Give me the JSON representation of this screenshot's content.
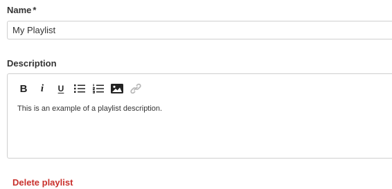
{
  "form": {
    "name_label": "Name",
    "required_marker": "*",
    "name_value": "My Playlist",
    "description_label": "Description",
    "description_text": "This is an example of a playlist description.",
    "delete_label": "Delete playlist"
  },
  "toolbar": {
    "bold_label": "B",
    "italic_label": "i",
    "underline_label": "U",
    "tools": [
      "bold",
      "italic",
      "underline",
      "bullet-list",
      "numbered-list",
      "image",
      "link"
    ]
  },
  "colors": {
    "text": "#333333",
    "border": "#cfcfcf",
    "danger": "#c9302c",
    "link_icon_disabled": "#b8b8b8"
  }
}
